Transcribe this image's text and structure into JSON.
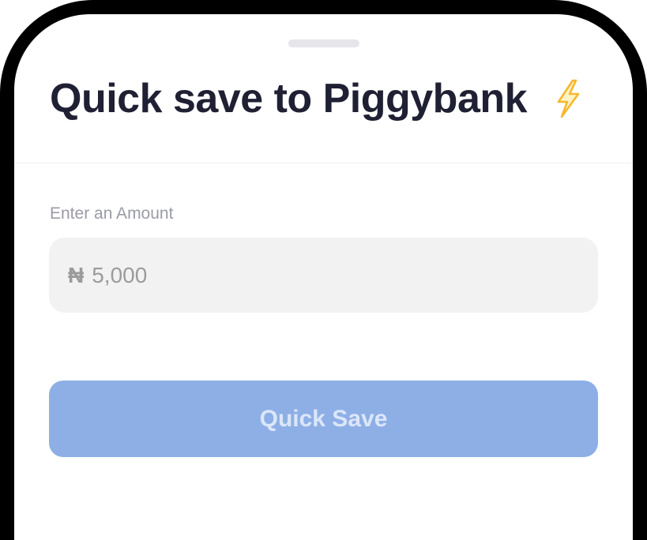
{
  "sheet": {
    "title": "Quick save to Piggybank",
    "title_icon": "lightning-bolt-icon"
  },
  "amount_field": {
    "label": "Enter an Amount",
    "currency_symbol": "₦",
    "value": "5,000"
  },
  "actions": {
    "quick_save_label": "Quick Save"
  },
  "colors": {
    "title": "#1f2033",
    "label": "#9a9ba6",
    "input_bg": "#f2f2f2",
    "button_bg": "#8eafe6",
    "button_text": "#dbe6f8",
    "bolt": "#f5b82e",
    "frame": "#000000"
  }
}
